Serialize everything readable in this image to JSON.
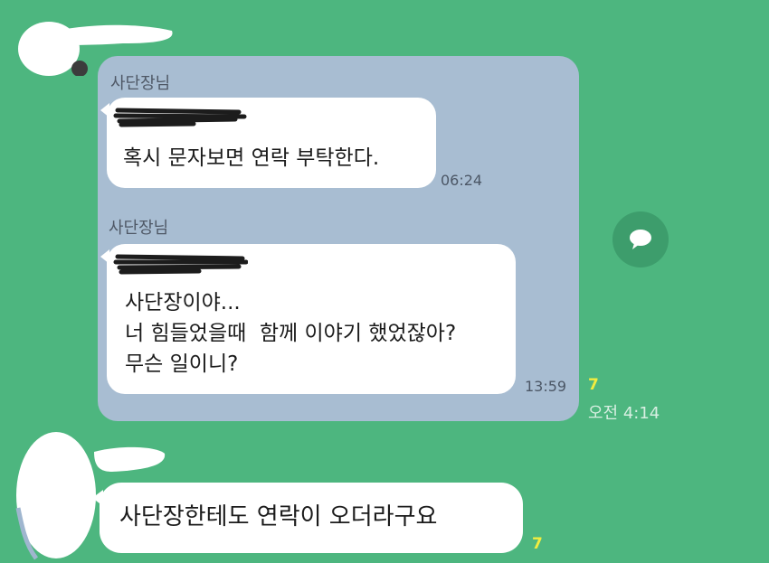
{
  "quoted": {
    "sender_1": "사단장님",
    "msg_1": "혹시 문자보면 연락 부탁한다.",
    "time_1": "06:24",
    "sender_2": "사단장님",
    "msg_2_line1": "사단장이야...",
    "msg_2_line2": "너 힘들었을때  함께 이야기 했었잖아?",
    "msg_2_line3": "무슨 일이니?",
    "time_2": "13:59"
  },
  "outer": {
    "unread_1": "7",
    "time": "오전 4:14",
    "reply": "사단장한테도 연락이 오더라구요",
    "unread_2": "7"
  },
  "colors": {
    "background": "#4db67f",
    "quoted_card": "#a8bdd2",
    "bubble": "#ffffff",
    "unread": "#f2ec3f"
  },
  "icons": {
    "share": "speech-bubble-icon"
  }
}
